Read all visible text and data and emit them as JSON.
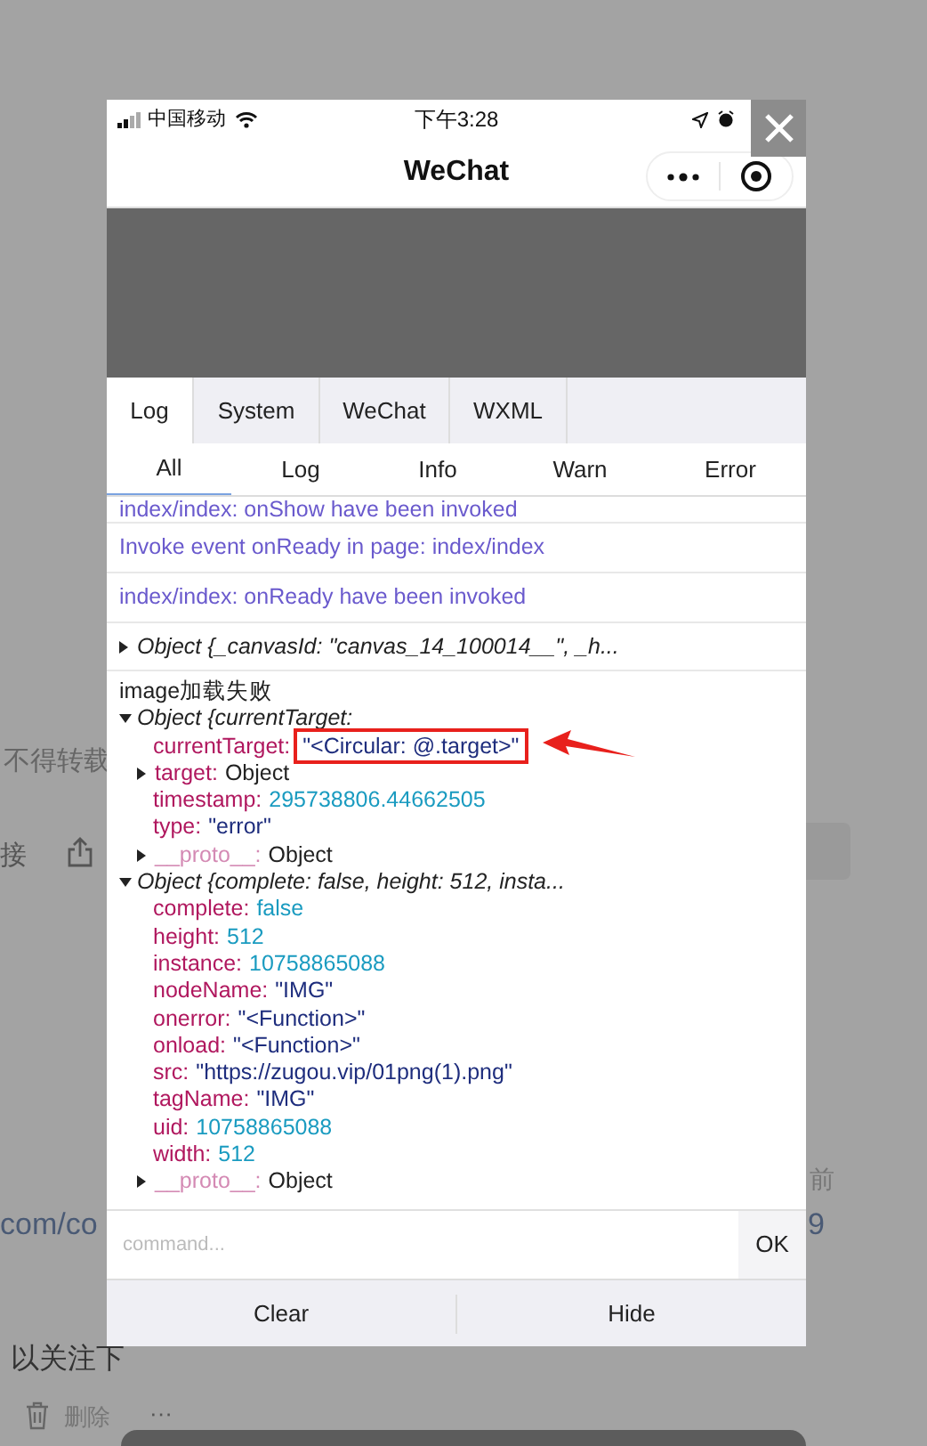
{
  "background_page": {
    "notice": "不得转载",
    "link_char": "接",
    "link_fragment": "com/co",
    "time_fragment": "前",
    "number_fragment": "9",
    "follow_text": "以关注下",
    "delete_label": "删除",
    "more_label": "···"
  },
  "status_bar": {
    "carrier": "中国移动",
    "time": "下午3:28"
  },
  "nav_bar": {
    "title": "WeChat"
  },
  "tabs": [
    {
      "label": "Log",
      "selected": true
    },
    {
      "label": "System",
      "selected": false
    },
    {
      "label": "WeChat",
      "selected": false
    },
    {
      "label": "WXML",
      "selected": false
    }
  ],
  "filters": [
    {
      "label": "All",
      "selected": true
    },
    {
      "label": "Log",
      "selected": false
    },
    {
      "label": "Info",
      "selected": false
    },
    {
      "label": "Warn",
      "selected": false
    },
    {
      "label": "Error",
      "selected": false
    }
  ],
  "logs": [
    {
      "kind": "line",
      "text": "index/index: onShow have been invoked"
    },
    {
      "kind": "line",
      "text": "Invoke event onReady in page: index/index"
    },
    {
      "kind": "line",
      "text": "index/index: onReady have been invoked"
    },
    {
      "kind": "object",
      "summary": "Object {_canvasId: \"canvas_14_100014__\", _h...",
      "expanded": false
    },
    {
      "kind": "group",
      "title": "image加载失败",
      "objects": [
        {
          "summary": "Object {currentTarget:",
          "expanded": true,
          "props": [
            {
              "key": "currentTarget:",
              "value": "\"<Circular: @.target>\"",
              "kind": "string",
              "expandable": false,
              "faded": false,
              "highlighted": true
            },
            {
              "key": "target:",
              "value": "Object",
              "kind": "object",
              "expandable": true,
              "faded": false,
              "highlighted": false
            },
            {
              "key": "timestamp:",
              "value": "295738806.44662505",
              "kind": "number",
              "expandable": false,
              "faded": false,
              "highlighted": false
            },
            {
              "key": "type:",
              "value": "\"error\"",
              "kind": "string",
              "expandable": false,
              "faded": false,
              "highlighted": false
            },
            {
              "key": "__proto__:",
              "value": "Object",
              "kind": "object",
              "expandable": true,
              "faded": true,
              "highlighted": false
            }
          ]
        },
        {
          "summary": "Object {complete: false, height: 512, insta...",
          "expanded": true,
          "props": [
            {
              "key": "complete:",
              "value": "false",
              "kind": "number",
              "expandable": false,
              "faded": false,
              "highlighted": false
            },
            {
              "key": "height:",
              "value": "512",
              "kind": "number",
              "expandable": false,
              "faded": false,
              "highlighted": false
            },
            {
              "key": "instance:",
              "value": "10758865088",
              "kind": "number",
              "expandable": false,
              "faded": false,
              "highlighted": false
            },
            {
              "key": "nodeName:",
              "value": "\"IMG\"",
              "kind": "string",
              "expandable": false,
              "faded": false,
              "highlighted": false
            },
            {
              "key": "onerror:",
              "value": "\"<Function>\"",
              "kind": "string",
              "expandable": false,
              "faded": false,
              "highlighted": false
            },
            {
              "key": "onload:",
              "value": "\"<Function>\"",
              "kind": "string",
              "expandable": false,
              "faded": false,
              "highlighted": false
            },
            {
              "key": "src:",
              "value": "\"https://zugou.vip/01png(1).png\"",
              "kind": "string",
              "expandable": false,
              "faded": false,
              "highlighted": false
            },
            {
              "key": "tagName:",
              "value": "\"IMG\"",
              "kind": "string",
              "expandable": false,
              "faded": false,
              "highlighted": false
            },
            {
              "key": "uid:",
              "value": "10758865088",
              "kind": "number",
              "expandable": false,
              "faded": false,
              "highlighted": false
            },
            {
              "key": "width:",
              "value": "512",
              "kind": "number",
              "expandable": false,
              "faded": false,
              "highlighted": false
            },
            {
              "key": "__proto__:",
              "value": "Object",
              "kind": "object",
              "expandable": true,
              "faded": true,
              "highlighted": false
            }
          ]
        }
      ]
    }
  ],
  "command": {
    "placeholder": "command...",
    "button": "OK"
  },
  "footer_buttons": [
    "Clear",
    "Hide"
  ]
}
